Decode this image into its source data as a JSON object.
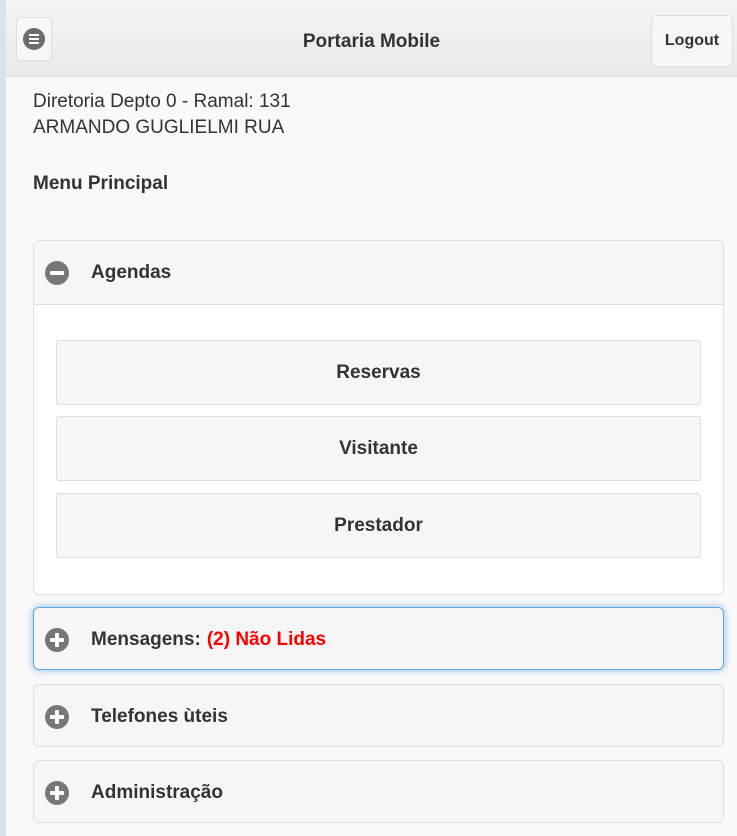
{
  "header": {
    "menu_icon": "list-menu-icon",
    "title": "Portaria Mobile",
    "logout_label": "Logout"
  },
  "user": {
    "department": "Diretoria Depto 0",
    "separator": "-",
    "extension_label": "Ramal: 131",
    "name": "ARMANDO GUGLIELMI RUA"
  },
  "menu": {
    "title": "Menu Principal",
    "sections": [
      {
        "label": "Agendas",
        "expanded": true,
        "items": [
          "Reservas",
          "Visitante",
          "Prestador"
        ]
      },
      {
        "label": "Mensagens:",
        "unread": "(2) Não Lidas",
        "expanded": false
      },
      {
        "label": "Telefones ùteis",
        "expanded": false
      },
      {
        "label": "Administração",
        "expanded": false
      }
    ]
  },
  "colors": {
    "accent_unread": "#ff0000",
    "focus_border": "#5fa7e0",
    "icon_gray": "#777777"
  }
}
